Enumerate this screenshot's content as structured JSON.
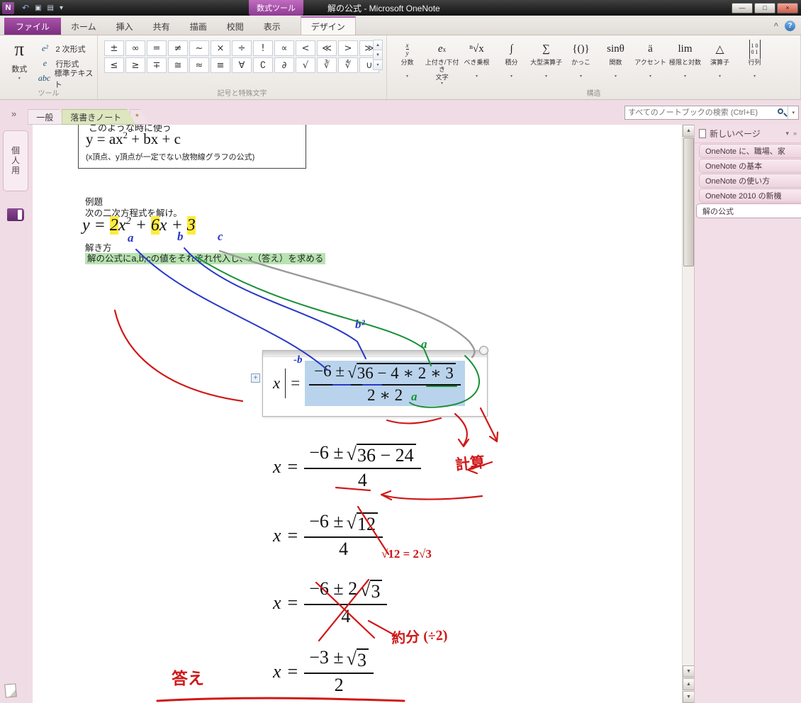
{
  "titlebar": {
    "app_icon": "N",
    "qat": {
      "back": "↶",
      "doc1": "▣",
      "doc2": "▤",
      "dropdown": "▾"
    },
    "contextual_group": "数式ツール",
    "title": "解の公式 - Microsoft OneNote",
    "window": {
      "minimize": "—",
      "maximize": "□",
      "close": "×"
    }
  },
  "ribbon": {
    "tabs": [
      {
        "label": "ファイル"
      },
      {
        "label": "ホーム"
      },
      {
        "label": "挿入"
      },
      {
        "label": "共有"
      },
      {
        "label": "描画"
      },
      {
        "label": "校閲"
      },
      {
        "label": "表示"
      },
      {
        "label": "デザイン"
      }
    ],
    "collapse_icon": "^",
    "help_icon": "?",
    "tools": {
      "group_label": "ツール",
      "equation_button": {
        "glyph": "π",
        "label": "数式",
        "arrow": "▾"
      },
      "buttons": [
        {
          "icon": "e²",
          "label": "2 次形式"
        },
        {
          "icon": "e",
          "label": "行形式"
        },
        {
          "icon": "abc",
          "label": "標準テキスト"
        }
      ]
    },
    "symbols": {
      "group_label": "記号と特殊文字",
      "row1": [
        "±",
        "∞",
        "=",
        "≠",
        "~",
        "×",
        "÷",
        "!",
        "∝",
        "<",
        "≪",
        ">",
        "≫"
      ],
      "row2": [
        "≤",
        "≥",
        "∓",
        "≅",
        "≈",
        "≡",
        "∀",
        "∁",
        "∂",
        "√",
        "∛",
        "∜",
        "∪"
      ],
      "scroll_up": "▲",
      "scroll_down": "▼",
      "scroll_more": "▾"
    },
    "structures": {
      "group_label": "構造",
      "arrow": "▾",
      "fraction": {
        "top": "x",
        "bottom": "y",
        "label": "分数"
      },
      "script": {
        "base": "e",
        "sup": "x",
        "label": "上付き/下付き\n文字"
      },
      "items": [
        {
          "glyph": "ⁿ√x",
          "label": "べき乗根"
        },
        {
          "glyph": "∫",
          "label": "積分"
        },
        {
          "glyph": "∑",
          "label": "大型演算子"
        },
        {
          "glyph": "{()}",
          "label": "かっこ"
        },
        {
          "glyph": "sinθ",
          "label": "関数"
        },
        {
          "glyph": "ä",
          "label": "アクセント"
        },
        {
          "glyph": "lim",
          "label": "極限と対数"
        },
        {
          "glyph": "△",
          "label": "演算子"
        }
      ],
      "matrix": {
        "rows": "1 0\n0 1",
        "label": "行列"
      }
    }
  },
  "navbar": {
    "expand_icon": "»",
    "section_tabs": [
      {
        "label": "一般"
      },
      {
        "label": "落書きノート"
      }
    ],
    "new_section_icon": "*",
    "search": {
      "placeholder": "すべてのノートブックの検索 (Ctrl+E)",
      "dropdown": "▾"
    }
  },
  "left_rail": {
    "notebook_label": "個人用"
  },
  "scrollbar": {
    "up": "▲",
    "down": "▼",
    "page_up": "▲",
    "page_down": "▼"
  },
  "page_panel": {
    "new_page_label": "新しいページ",
    "arrow1": "▾",
    "arrow2": "»",
    "pages": [
      {
        "label": "OneNote に、職場、家"
      },
      {
        "label": "OneNote の基本"
      },
      {
        "label": "OneNote の使い方"
      },
      {
        "label": "OneNote 2010 の新機"
      },
      {
        "label": "解の公式"
      }
    ]
  },
  "canvas": {
    "formula_box": {
      "clipped_line": "このような時に使う",
      "formula_pre": "y = ax",
      "formula_sup": "2",
      "formula_post": " + bx + c",
      "caption": "(x頂点、y頂点が一定でない放物線グラフの公式)"
    },
    "problem": {
      "heading": "例題",
      "statement": "次の二次方程式を解け。",
      "eq_pre": "y = ",
      "eq_a": "2",
      "eq_x1": "x",
      "eq_sup": "2",
      "eq_plus": " + ",
      "eq_b": "6",
      "eq_x2": "x + ",
      "eq_c": "3",
      "method_label": "解き方",
      "method_text": "解の公式にa,b,cの値をそれぞれ代入し、x（答え）を求める"
    },
    "ink_labels": {
      "a": "a",
      "b": "b",
      "c": "c",
      "minus_b": "-b",
      "b_squared": "b²",
      "a_green_1": "a",
      "a_green_2": "a"
    },
    "formula_entry": {
      "lhs": "x",
      "equals": "=",
      "num_pre": "−6 ±",
      "num_sqrt": "36 − 4 ∗ 2 ∗ 3",
      "den": "2 ∗ 2",
      "handle": "+"
    },
    "steps": [
      {
        "lhs": "x",
        "equals": "=",
        "num_pre": "−6 ±",
        "num_sqrt": "36 − 24",
        "den": "4"
      },
      {
        "lhs": "x",
        "equals": "=",
        "num_pre": "−6 ±",
        "num_sqrt": "12",
        "den": "4"
      },
      {
        "lhs": "x",
        "equals": "=",
        "num_pre": "−6 ± 2",
        "num_sqrt": "3",
        "den": "4"
      },
      {
        "lhs": "x",
        "equals": "=",
        "num_pre": "−3 ±",
        "num_sqrt": "3",
        "den": "2"
      }
    ],
    "red_notes": {
      "keisan": "計算",
      "root12": "√12 = 2√3",
      "yakubun": "約分 (÷2)",
      "kotae": "答え"
    }
  },
  "colors": {
    "accent_purple": "#8e3a92",
    "highlight_yellow": "#ffec3d",
    "highlight_green": "#b7e3b0",
    "selection_blue": "#b9d3ec",
    "ink_red": "#d01818",
    "ink_blue": "#2838c8",
    "ink_green": "#189038",
    "ink_gray": "#9a9a9a"
  }
}
